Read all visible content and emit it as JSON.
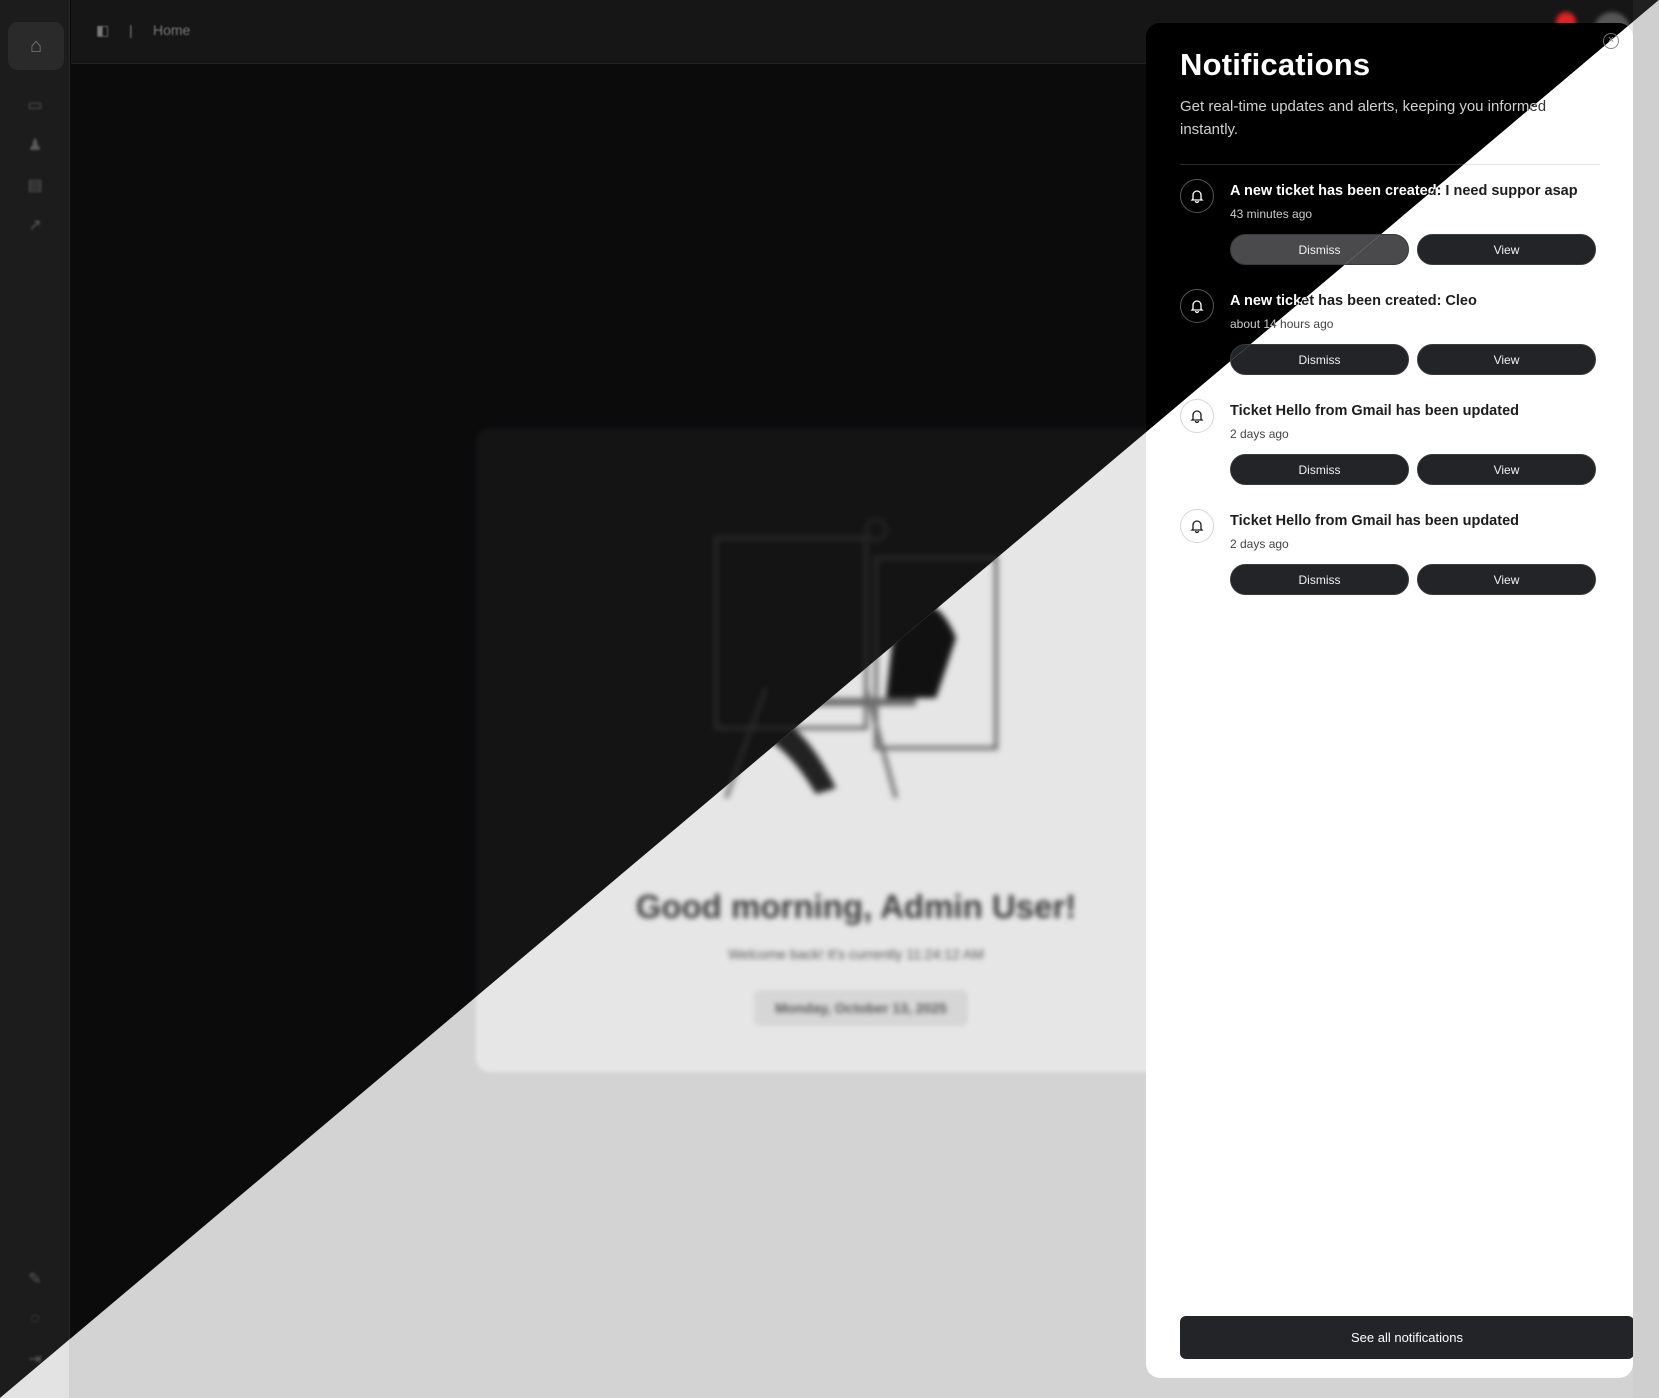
{
  "topbar": {
    "breadcrumb_current": "Home"
  },
  "welcome": {
    "title": "Good morning, Admin User!",
    "subtitle": "Welcome back! It's currently 11:24:12 AM",
    "date": "Monday, October 13, 2025"
  },
  "notifications": {
    "title": "Notifications",
    "description": "Get real-time updates and alerts, keeping you informed instantly.",
    "close_symbol": "×",
    "dismiss_label": "Dismiss",
    "view_label": "View",
    "footer_label": "See all notifications",
    "items": [
      {
        "title": "A new ticket has been created: I need suppor asap",
        "time": "43 minutes ago"
      },
      {
        "title": "A new ticket has been created: Cleo",
        "time": "about 14 hours ago"
      },
      {
        "title": "Ticket Hello from Gmail has been updated",
        "time": "2 days ago"
      },
      {
        "title": "Ticket Hello from Gmail has been updated",
        "time": "2 days ago"
      }
    ]
  },
  "icons": {
    "sidebar": [
      "home-icon",
      "ticket-icon",
      "user-icon",
      "table-icon",
      "chart-icon",
      "edit-icon",
      "help-icon",
      "logout-icon"
    ],
    "bell": "bell-icon",
    "close": "close-icon"
  },
  "colors": {
    "panel_dark": "#000000",
    "panel_light": "#ffffff",
    "button": "#232427",
    "button_hover": "#4a4a4c",
    "alert_dot": "#dd2222"
  }
}
